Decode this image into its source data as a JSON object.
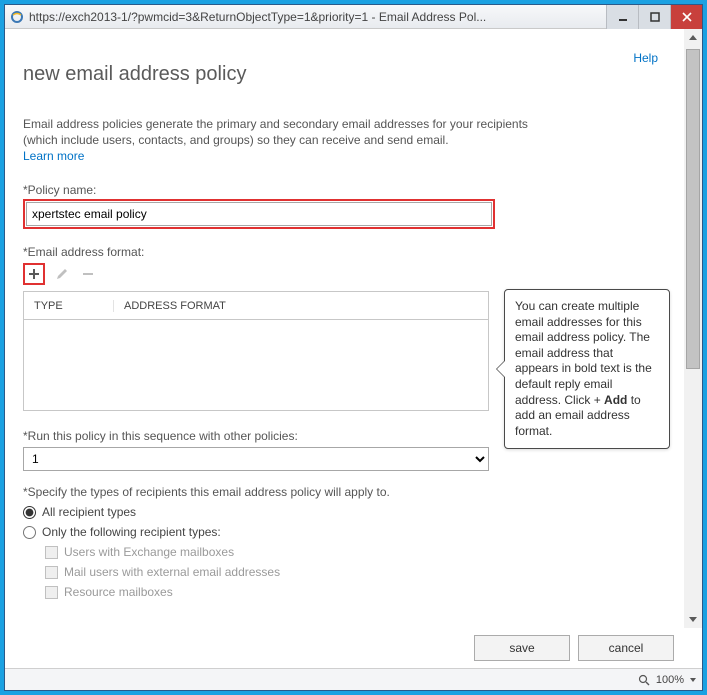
{
  "window": {
    "url": "https://exch2013-1/?pwmcid=3&ReturnObjectType=1&priority=1 - Email Address Pol..."
  },
  "header": {
    "help": "Help",
    "title": "new email address policy"
  },
  "intro": {
    "text": "Email address policies generate the primary and secondary email addresses for your recipients (which include users, contacts, and groups) so they can receive and send email.",
    "learn_more": "Learn more"
  },
  "fields": {
    "policy_name_label": "*Policy name:",
    "policy_name_value": "xpertstec email policy",
    "email_format_label": "*Email address format:",
    "table": {
      "col_type": "TYPE",
      "col_format": "ADDRESS FORMAT"
    },
    "sequence_label": "*Run this policy in this sequence with other policies:",
    "sequence_value": "1",
    "recipients_label": "*Specify the types of recipients this email address policy will apply to.",
    "opt_all": "All recipient types",
    "opt_only": "Only the following recipient types:",
    "chk_users_exchange": "Users with Exchange mailboxes",
    "chk_mail_users": "Mail users with external email addresses",
    "chk_resource": "Resource mailboxes"
  },
  "callout": {
    "text_before_bold": "You can create multiple email addresses for this email address policy. The email address that appears in bold text is the default reply email address. Click + ",
    "bold": "Add",
    "text_after_bold": " to add an email address format."
  },
  "footer": {
    "save": "save",
    "cancel": "cancel"
  },
  "statusbar": {
    "zoom": "100%"
  }
}
